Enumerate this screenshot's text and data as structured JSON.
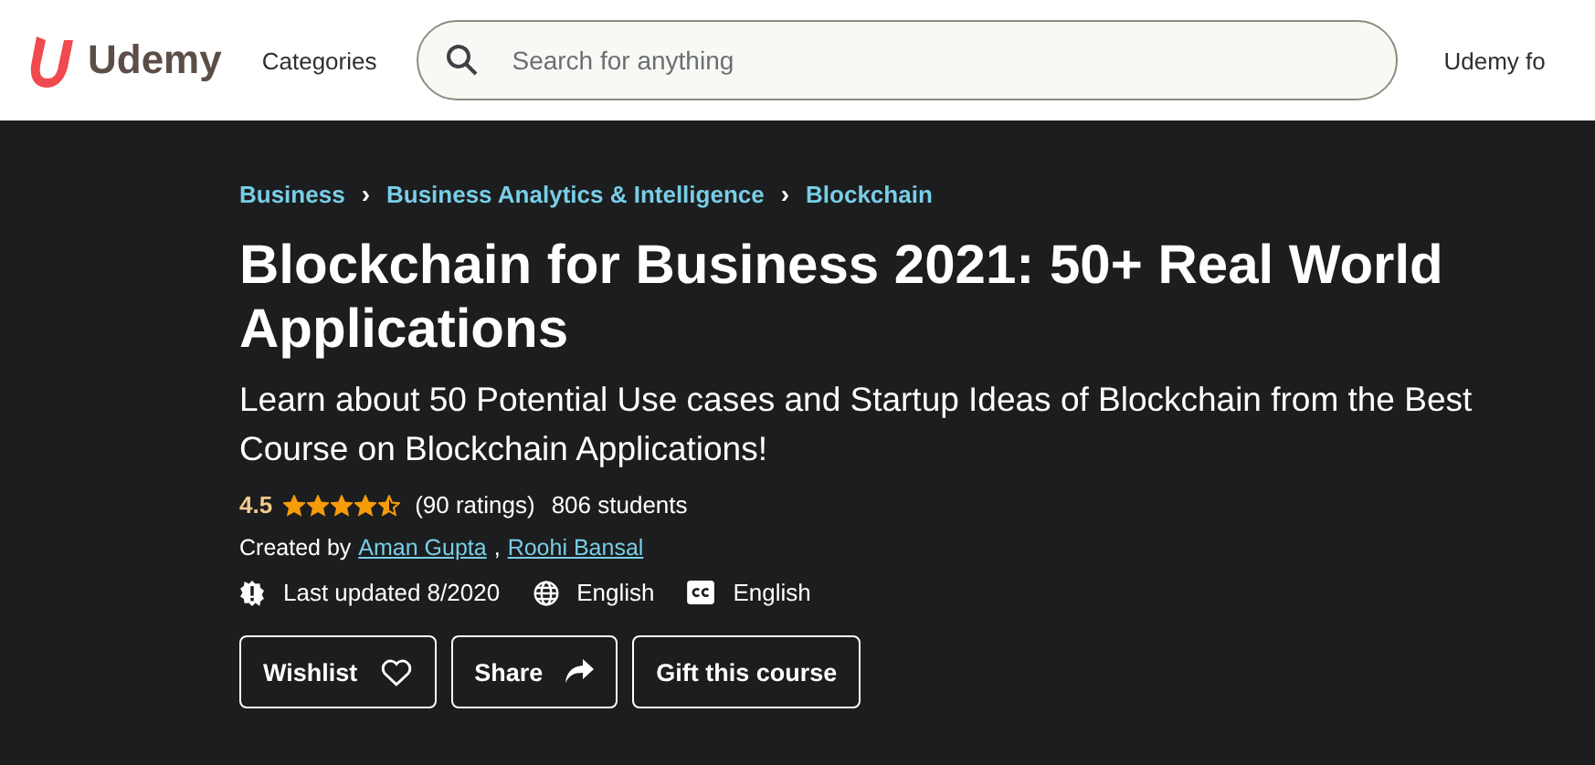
{
  "header": {
    "logo_text": "Udemy",
    "categories": "Categories",
    "search": {
      "placeholder": "Search for anything"
    },
    "right_link": "Udemy fo"
  },
  "breadcrumbs": [
    "Business",
    "Business Analytics & Intelligence",
    "Blockchain"
  ],
  "breadcrumb_separator": "›",
  "title": "Blockchain for Business 2021: 50+ Real World Applications",
  "subtitle": "Learn about 50 Potential Use cases and Startup Ideas of Blockchain from the Best Course on Blockchain Applications!",
  "rating": {
    "score": "4.5",
    "stars": 4.5,
    "count": "(90 ratings)",
    "students": "806 students"
  },
  "created": {
    "label": "Created by",
    "authors": [
      "Aman Gupta",
      "Roohi Bansal"
    ],
    "separator": ","
  },
  "meta": [
    {
      "kind": "updated",
      "text": "Last updated 8/2020"
    },
    {
      "kind": "language",
      "text": "English"
    },
    {
      "kind": "captions",
      "text": "English"
    }
  ],
  "buttons": [
    {
      "label": "Wishlist",
      "kind": "wishlist"
    },
    {
      "label": "Share",
      "kind": "share"
    },
    {
      "label": "Gift this course",
      "kind": "gift"
    }
  ]
}
